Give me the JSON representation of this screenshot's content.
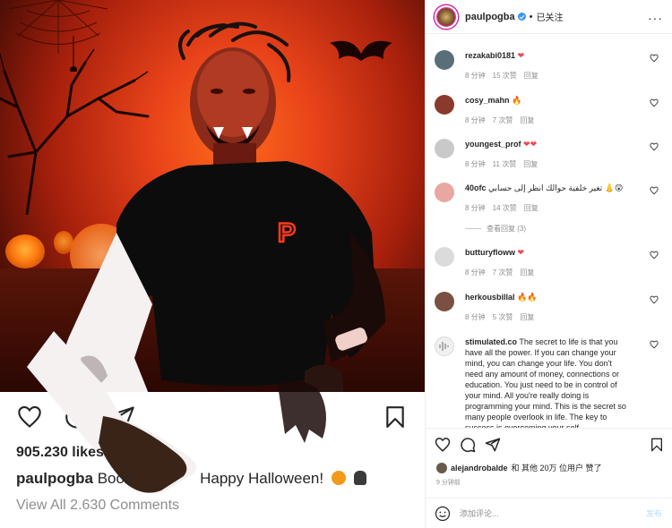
{
  "post": {
    "likes": "905.230 likes",
    "caption_user": "paulpogba",
    "caption_text_a": "Booo",
    "caption_text_b": "Happy Halloween!",
    "view_all": "View All 2.630 Comments",
    "shirt_logo": "P"
  },
  "header": {
    "username": "paulpogba",
    "separator": "•",
    "follow_status": "已关注",
    "more": "···"
  },
  "comments": [
    {
      "user": "rezakabi0181",
      "text": "",
      "emoji": "❤",
      "time": "8 分钟",
      "likes": "15 次赞",
      "reply": "回复",
      "avatar": "#5a6e7a"
    },
    {
      "user": "cosy_mahn",
      "text": "",
      "emoji": "🔥",
      "time": "8 分钟",
      "likes": "7 次赞",
      "reply": "回复",
      "avatar": "#8a3a2a"
    },
    {
      "user": "youngest_prof",
      "text": "",
      "emoji": "❤❤",
      "time": "8 分钟",
      "likes": "11 次赞",
      "reply": "回复",
      "avatar": "#c9c9c9"
    },
    {
      "user": "40ofc",
      "text": "تغير خلفية حوالك انظر إلى حسابي",
      "emoji": "👃😲",
      "time": "8 分钟",
      "likes": "14 次赞",
      "reply": "回复",
      "avatar": "#e8a7a0"
    },
    {
      "user": "butturyfloww",
      "text": "",
      "emoji": "❤",
      "time": "8 分钟",
      "likes": "7 次赞",
      "reply": "回复",
      "avatar": "#dbdbdb"
    },
    {
      "user": "herkousbillal",
      "text": "",
      "emoji": "🔥🔥",
      "time": "8 分钟",
      "likes": "5 次赞",
      "reply": "回复",
      "avatar": "#7a5040"
    },
    {
      "user": "stimulated.co",
      "text": "The secret to life is that you have all the power. If you can change your mind, you can change your life. You don't need any amount of money, connections or education. You just need to be in control of your mind. All you're really doing is programming your mind. This is the secret so many people overlook in life. The key to success is overcoming your self",
      "emoji": "",
      "time": "",
      "likes": "",
      "reply": "",
      "avatar": "#e9e9e9"
    }
  ],
  "view_replies": "查看回复 (3)",
  "liked_by": {
    "user": "alejandrobalde",
    "rest": "和 其他 20万 位用户 赞了"
  },
  "time_ago": "9 分钟前",
  "add_comment": {
    "placeholder": "添加评论...",
    "post": "发布"
  },
  "icons": {
    "like": "heart-icon",
    "comment": "comment-icon",
    "share": "share-icon",
    "save": "bookmark-icon",
    "emoji": "smiley-icon"
  },
  "colors": {
    "fire_orange": "#e8431a",
    "heart_red": "#ed4956",
    "verified_blue": "#3897f0",
    "post_link": "#b2dffc"
  }
}
